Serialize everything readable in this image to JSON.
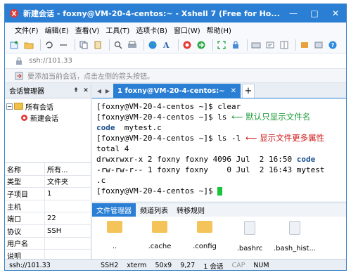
{
  "window": {
    "title": "新建会话 - foxny@VM-20-4-centos:~ - Xshell 7 (Free for Ho...",
    "controls": [
      "—",
      "□",
      "✕"
    ]
  },
  "menu": [
    "文件(F)",
    "编辑(E)",
    "查看(V)",
    "工具(T)",
    "选项卡(B)",
    "窗口(W)",
    "帮助(H)"
  ],
  "address": {
    "value": "ssh://101.33"
  },
  "hint": {
    "text": "要添加当前会话，点击左侧的箭头按钮。"
  },
  "session_manager": {
    "title": "会话管理器",
    "pin": "⇞",
    "close": "✕",
    "root": "所有会话",
    "child": "新建会话",
    "expander": "−"
  },
  "properties": [
    {
      "key": "名称",
      "value": "所有..."
    },
    {
      "key": "类型",
      "value": "文件夹"
    },
    {
      "key": "子项目",
      "value": "1"
    },
    {
      "key": "主机",
      "value": ""
    },
    {
      "key": "端口",
      "value": "22"
    },
    {
      "key": "协议",
      "value": "SSH"
    },
    {
      "key": "用户名",
      "value": ""
    },
    {
      "key": "说明",
      "value": ""
    }
  ],
  "tabs": {
    "nav_left": "◀",
    "nav_right": "▶",
    "active_label": "1 foxny@VM-20-4-centos:~",
    "close": "✕",
    "add": "+"
  },
  "terminal": {
    "lines": [
      {
        "prompt": "[foxny@VM-20-4-centos ~]$ ",
        "cmd": "clear"
      },
      {
        "prompt": "[foxny@VM-20-4-centos ~]$ ",
        "cmd": "ls",
        "note": "⟵ 默认只显示文件名"
      },
      {
        "dir": "code",
        "rest": "  mytest.c"
      },
      {
        "prompt": "[foxny@VM-20-4-centos ~]$ ",
        "cmd": "ls -l",
        "note": "⟵ 显示文件更多属性"
      },
      {
        "text": "total 4"
      },
      {
        "text": "drwxrwxr-x 2 foxny foxny 4096 Jul  2 16:50 ",
        "dir": "code"
      },
      {
        "text": "-rw-rw-r-- 1 foxny foxny    0 Jul  2 16:43 mytest"
      },
      {
        "text": ".c"
      },
      {
        "prompt": "[foxny@VM-20-4-centos ~]$ "
      }
    ]
  },
  "file_manager": {
    "tabs": [
      "文件管理器",
      "频道列表",
      "转移规则"
    ],
    "items": [
      "..",
      ".cache",
      ".config",
      ".bashrc",
      ".bash_hist..."
    ]
  },
  "status": {
    "address": "ssh://101.33",
    "protocol": "SSH2",
    "terminal": "xterm",
    "size": "50x9",
    "position": "9,27",
    "sessions": "1 会话",
    "caps": "CAP",
    "num": "NUM"
  },
  "colors": {
    "accent": "#2a7fd4",
    "note_red": "#d11a1a",
    "note_green": "#1f9b3a",
    "dir_blue": "#1a4d8f",
    "cursor": "#18c43a"
  }
}
